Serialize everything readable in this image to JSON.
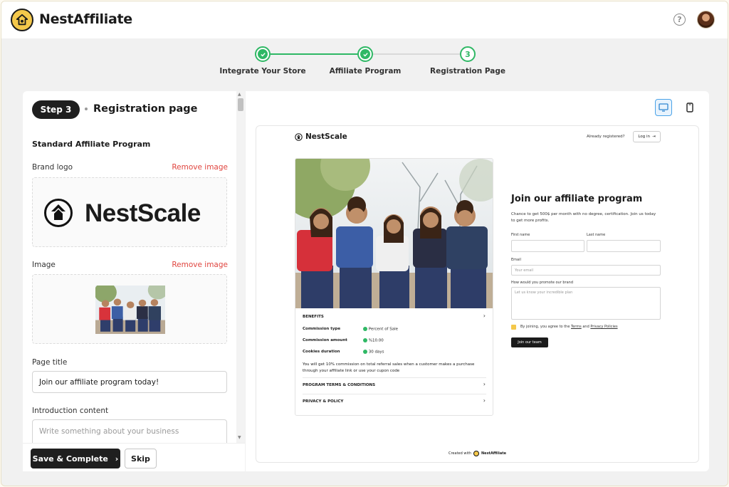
{
  "app": {
    "brand": "NestAffiliate"
  },
  "stepper": {
    "steps": [
      {
        "label": "Integrate Your Store",
        "state": "done"
      },
      {
        "label": "Affiliate Program",
        "state": "done"
      },
      {
        "label": "Registration Page",
        "state": "current",
        "number": "3"
      }
    ]
  },
  "left_panel": {
    "step_badge": "Step 3",
    "title": "Registration page",
    "program_name": "Standard Affiliate Program",
    "brand_logo_label": "Brand logo",
    "remove_image": "Remove image",
    "logo_text": "NestScale",
    "image_label": "Image",
    "page_title_label": "Page title",
    "page_title_value": "Join our affiliate program today!",
    "intro_label": "Introduction content",
    "intro_placeholder": "Write something about your business",
    "save_button": "Save & Complete",
    "skip_button": "Skip"
  },
  "preview": {
    "brand": "NestScale",
    "already_registered": "Already registered?",
    "login": "Log in",
    "benefits_title": "BENEFITS",
    "benefits": [
      {
        "label": "Commission type",
        "value": "Percent of Sale"
      },
      {
        "label": "Commission amount",
        "value": "%10.00"
      },
      {
        "label": "Cookies duration",
        "value": "30 days"
      }
    ],
    "benefits_note": "You will get 10% commission on total referral sales when a customer makes a purchase through your affiliate link or use your cupon code",
    "terms": "PROGRAM TERMS & CONDITIONS",
    "privacy": "PRIVACY & POLICY",
    "heading": "Join our affiliate program",
    "subtext": "Chance to get 500$ per month with no degree, certification. Join us today to get more profits.",
    "first_name_label": "First name",
    "last_name_label": "Last name",
    "email_label": "Email",
    "email_placeholder": "Your email",
    "promote_label": "How would you promote our brand",
    "promote_placeholder": "Let us know your incredible plan",
    "agree_prefix": "By joining, you agree to the",
    "agree_terms": "Terms",
    "agree_and": "and",
    "agree_privacy": "Privacy Policies",
    "join_button": "Join our team",
    "created_with": "Created with",
    "created_brand": "NestAffiliate"
  },
  "colors": {
    "accent_green": "#2fb865",
    "brand_yellow": "#f4c84b",
    "danger_red": "#e0453f",
    "dark": "#1f1f1f"
  }
}
